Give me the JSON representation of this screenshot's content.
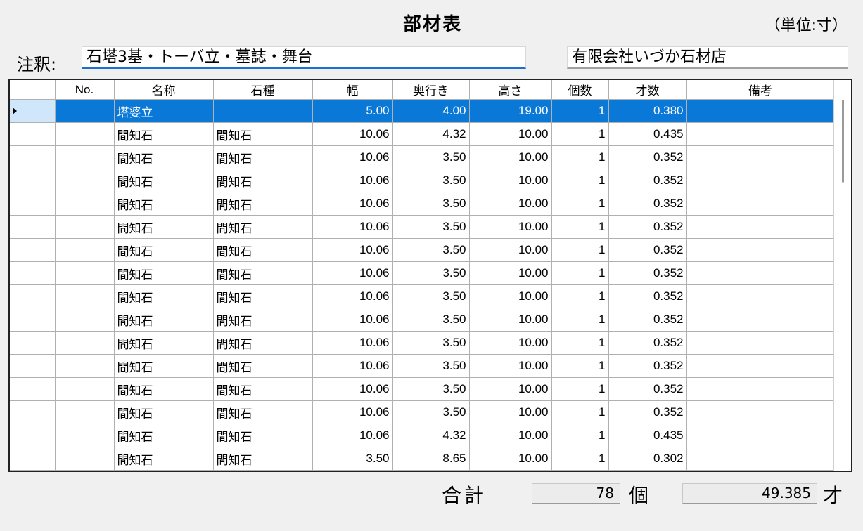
{
  "header": {
    "title": "部材表",
    "unit_label": "（単位:寸）"
  },
  "note": {
    "label": "注釈:",
    "value": "石塔3基・トーバ立・墓誌・舞台"
  },
  "company": {
    "value": "有限会社いづか石材店"
  },
  "table": {
    "columns": [
      "",
      "No.",
      "名称",
      "石種",
      "幅",
      "奥行き",
      "高さ",
      "個数",
      "才数",
      "備考"
    ],
    "rows": [
      {
        "no": "",
        "name": "塔婆立",
        "stone": "",
        "w": "5.00",
        "d": "4.00",
        "h": "19.00",
        "qty": "1",
        "sai": "0.380",
        "note": ""
      },
      {
        "no": "",
        "name": "間知石",
        "stone": "間知石",
        "w": "10.06",
        "d": "4.32",
        "h": "10.00",
        "qty": "1",
        "sai": "0.435",
        "note": ""
      },
      {
        "no": "",
        "name": "間知石",
        "stone": "間知石",
        "w": "10.06",
        "d": "3.50",
        "h": "10.00",
        "qty": "1",
        "sai": "0.352",
        "note": ""
      },
      {
        "no": "",
        "name": "間知石",
        "stone": "間知石",
        "w": "10.06",
        "d": "3.50",
        "h": "10.00",
        "qty": "1",
        "sai": "0.352",
        "note": ""
      },
      {
        "no": "",
        "name": "間知石",
        "stone": "間知石",
        "w": "10.06",
        "d": "3.50",
        "h": "10.00",
        "qty": "1",
        "sai": "0.352",
        "note": ""
      },
      {
        "no": "",
        "name": "間知石",
        "stone": "間知石",
        "w": "10.06",
        "d": "3.50",
        "h": "10.00",
        "qty": "1",
        "sai": "0.352",
        "note": ""
      },
      {
        "no": "",
        "name": "間知石",
        "stone": "間知石",
        "w": "10.06",
        "d": "3.50",
        "h": "10.00",
        "qty": "1",
        "sai": "0.352",
        "note": ""
      },
      {
        "no": "",
        "name": "間知石",
        "stone": "間知石",
        "w": "10.06",
        "d": "3.50",
        "h": "10.00",
        "qty": "1",
        "sai": "0.352",
        "note": ""
      },
      {
        "no": "",
        "name": "間知石",
        "stone": "間知石",
        "w": "10.06",
        "d": "3.50",
        "h": "10.00",
        "qty": "1",
        "sai": "0.352",
        "note": ""
      },
      {
        "no": "",
        "name": "間知石",
        "stone": "間知石",
        "w": "10.06",
        "d": "3.50",
        "h": "10.00",
        "qty": "1",
        "sai": "0.352",
        "note": ""
      },
      {
        "no": "",
        "name": "間知石",
        "stone": "間知石",
        "w": "10.06",
        "d": "3.50",
        "h": "10.00",
        "qty": "1",
        "sai": "0.352",
        "note": ""
      },
      {
        "no": "",
        "name": "間知石",
        "stone": "間知石",
        "w": "10.06",
        "d": "3.50",
        "h": "10.00",
        "qty": "1",
        "sai": "0.352",
        "note": ""
      },
      {
        "no": "",
        "name": "間知石",
        "stone": "間知石",
        "w": "10.06",
        "d": "3.50",
        "h": "10.00",
        "qty": "1",
        "sai": "0.352",
        "note": ""
      },
      {
        "no": "",
        "name": "間知石",
        "stone": "間知石",
        "w": "10.06",
        "d": "3.50",
        "h": "10.00",
        "qty": "1",
        "sai": "0.352",
        "note": ""
      },
      {
        "no": "",
        "name": "間知石",
        "stone": "間知石",
        "w": "10.06",
        "d": "4.32",
        "h": "10.00",
        "qty": "1",
        "sai": "0.435",
        "note": ""
      },
      {
        "no": "",
        "name": "間知石",
        "stone": "間知石",
        "w": "3.50",
        "d": "8.65",
        "h": "10.00",
        "qty": "1",
        "sai": "0.302",
        "note": ""
      }
    ]
  },
  "totals": {
    "label": "合計",
    "count": "78",
    "count_unit": "個",
    "sai": "49.385",
    "sai_unit": "才"
  },
  "colors": {
    "selection": "#0a78d7",
    "focus_underline": "#1a6fd2"
  }
}
